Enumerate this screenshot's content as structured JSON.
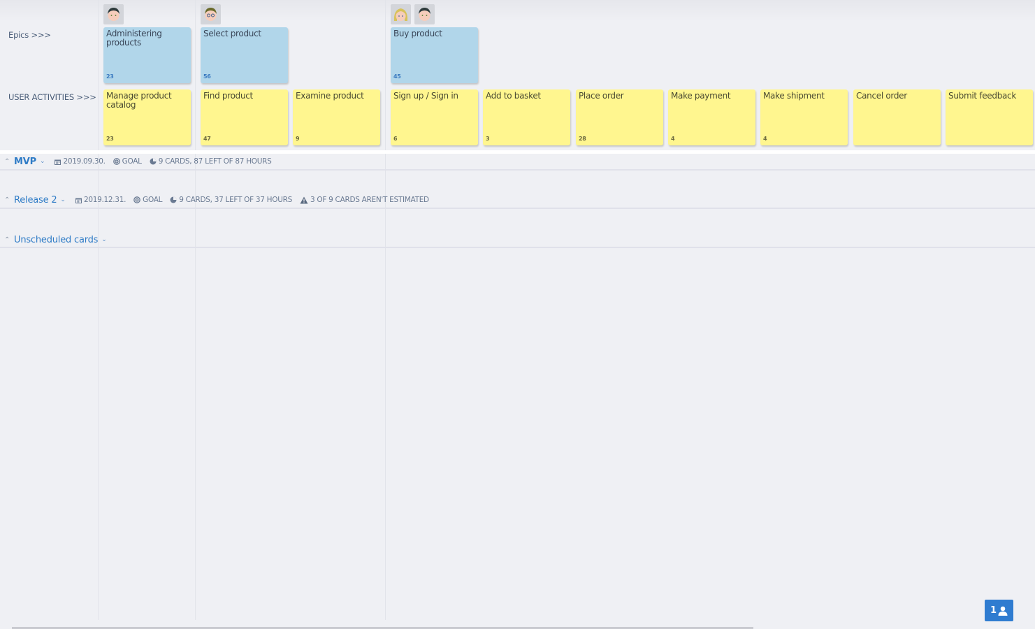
{
  "rows": {
    "epics_label": "Epics >>>",
    "activities_label": "USER ACTIVITIES >>>"
  },
  "epics": [
    {
      "title": "Administering products",
      "estimate": "23",
      "avatars": [
        "male-dark-hair"
      ]
    },
    {
      "title": "Select product",
      "estimate": "56",
      "avatars": [
        "male-glasses"
      ]
    },
    {
      "title": "Buy product",
      "estimate": "45",
      "avatars": [
        "female-blonde",
        "male-dark-hair"
      ]
    }
  ],
  "activities": [
    {
      "title": "Manage product catalog",
      "estimate": "23"
    },
    {
      "title": "Find product",
      "estimate": "47"
    },
    {
      "title": "Examine product",
      "estimate": "9"
    },
    {
      "title": "Sign up / Sign in",
      "estimate": "6"
    },
    {
      "title": "Add to basket",
      "estimate": "3"
    },
    {
      "title": "Place order",
      "estimate": "28"
    },
    {
      "title": "Make payment",
      "estimate": "4"
    },
    {
      "title": "Make shipment",
      "estimate": "4"
    },
    {
      "title": "Cancel order",
      "estimate": ""
    },
    {
      "title": "Submit feedback",
      "estimate": ""
    }
  ],
  "releases": [
    {
      "name": "MVP",
      "date": "2019.09.30.",
      "goal": "GOAL",
      "summary": "9 CARDS, 87 LEFT OF 87 HOURS",
      "warning": ""
    },
    {
      "name": "Release 2",
      "date": "2019.12.31.",
      "goal": "GOAL",
      "summary": "9 CARDS, 37 LEFT OF 37 HOURS",
      "warning": "3 OF 9 CARDS AREN'T ESTIMATED"
    },
    {
      "name": "Unscheduled cards"
    }
  ],
  "online_users": {
    "count": "1"
  },
  "colors": {
    "epic_card": "#b1d6ea",
    "activity_card": "#fff68f",
    "accent": "#2e7bc6",
    "background": "#eff0f4"
  }
}
